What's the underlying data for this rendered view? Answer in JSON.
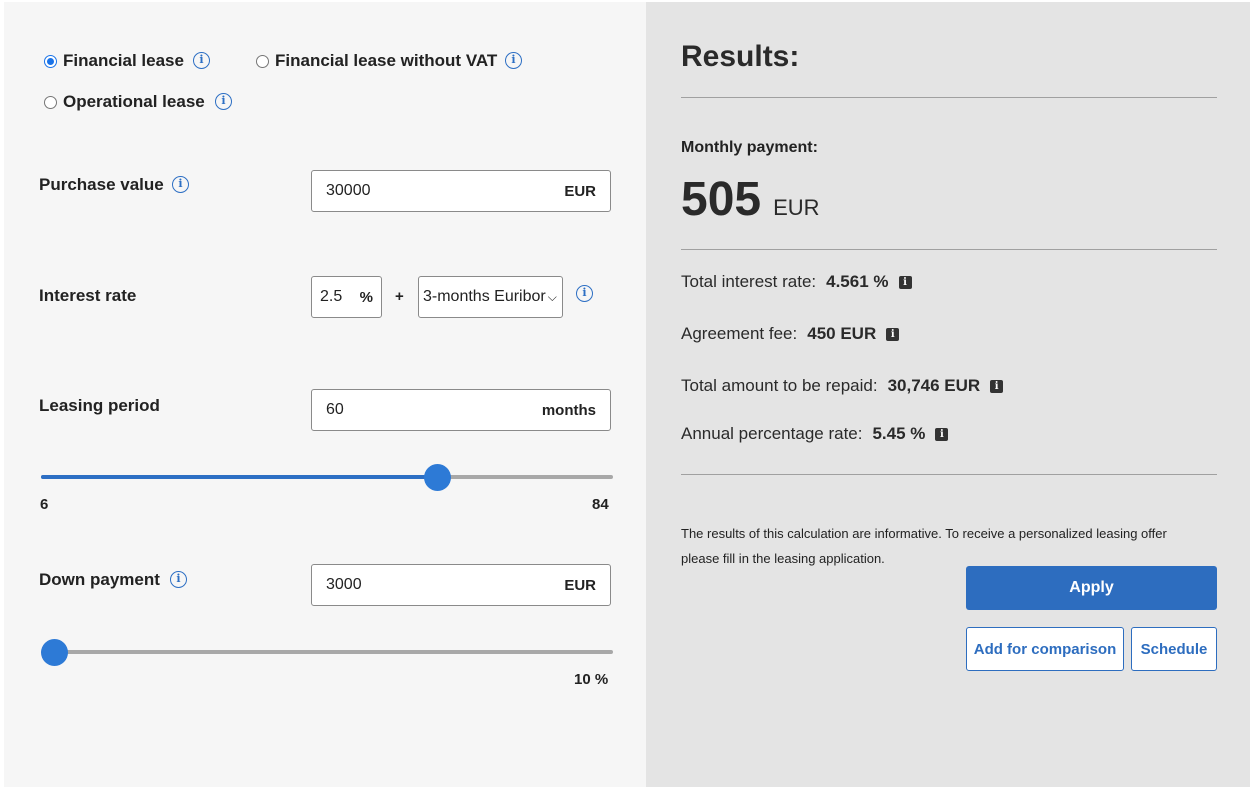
{
  "lease_types": {
    "financial": {
      "label": "Financial lease",
      "selected": true
    },
    "financial_no_vat": {
      "label": "Financial lease without VAT",
      "selected": false
    },
    "operational": {
      "label": "Operational lease",
      "selected": false
    }
  },
  "info_glyph": "i",
  "purchase": {
    "label": "Purchase value",
    "value": "30000",
    "unit": "EUR"
  },
  "interest": {
    "label": "Interest rate",
    "value": "2.5",
    "unit": "%",
    "plus": "+",
    "base_selected": "3-months Euribor"
  },
  "period": {
    "label": "Leasing period",
    "value": "60",
    "unit": "months",
    "min_label": "6",
    "max_label": "84",
    "min": 6,
    "max": 84,
    "current": 60
  },
  "down": {
    "label": "Down payment",
    "value": "3000",
    "unit": "EUR",
    "percent_label": "10 %",
    "slider_fraction": 0.0
  },
  "results": {
    "title": "Results:",
    "monthly_label": "Monthly payment:",
    "monthly_value": "505",
    "monthly_currency": "EUR",
    "rows": [
      {
        "label": "Total interest rate:",
        "value": "4.561 %"
      },
      {
        "label": "Agreement fee:",
        "value": "450 EUR"
      },
      {
        "label": "Total amount to be repaid:",
        "value": "30,746 EUR"
      },
      {
        "label": "Annual percentage rate:",
        "value": "5.45 %"
      }
    ],
    "note": "The results of this calculation are informative. To receive a personalized leasing offer please fill in the leasing application.",
    "apply_label": "Apply",
    "compare_label": "Add for comparison",
    "schedule_label": "Schedule"
  },
  "colors": {
    "accent": "#2d6dbf",
    "left_bg": "#f6f6f6",
    "right_bg": "#e4e4e4"
  }
}
